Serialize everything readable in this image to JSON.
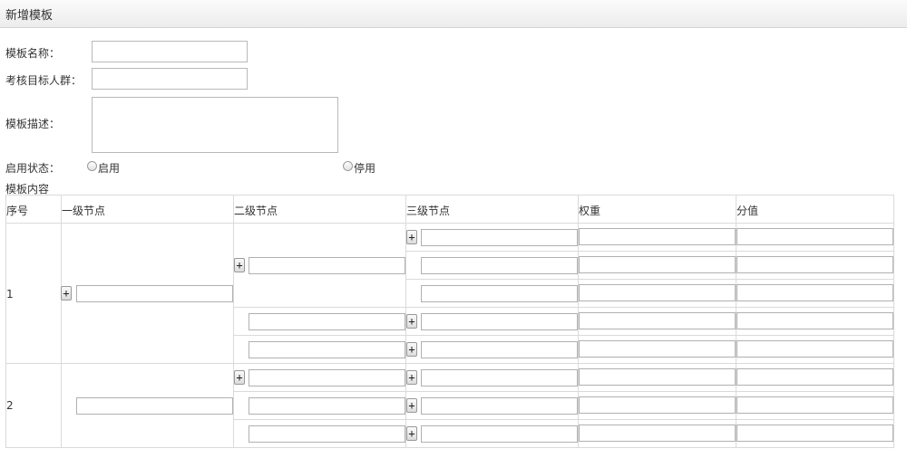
{
  "header": {
    "title": "新增模板"
  },
  "form": {
    "name_label": "模板名称：",
    "name_value": "",
    "target_label": "考核目标人群：",
    "target_value": "",
    "desc_label": "模板描述：",
    "desc_value": "",
    "status_label": "启用状态：",
    "status_options": [
      "启用",
      "停用"
    ]
  },
  "content": {
    "section_label": "模板内容",
    "columns": [
      "序号",
      "一级节点",
      "二级节点",
      "三级节点",
      "权重",
      "分值"
    ],
    "plus_label": "+",
    "rows": [
      {
        "seq": "1"
      },
      {
        "seq": "2"
      }
    ]
  }
}
